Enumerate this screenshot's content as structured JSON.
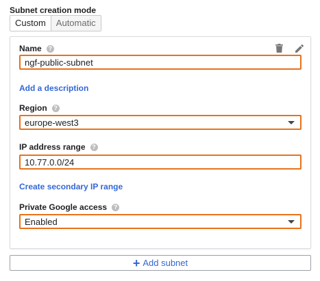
{
  "mode": {
    "label": "Subnet creation mode",
    "options": [
      "Custom",
      "Automatic"
    ],
    "selected": "Custom"
  },
  "card": {
    "name": {
      "label": "Name",
      "value": "ngf-public-subnet",
      "help_icon": "help-icon"
    },
    "add_description": "Add a description",
    "region": {
      "label": "Region",
      "value": "europe-west3",
      "help_icon": "help-icon"
    },
    "ip_range": {
      "label": "IP address range",
      "value": "10.77.0.0/24",
      "help_icon": "help-icon"
    },
    "secondary_range": "Create secondary IP range",
    "private_access": {
      "label": "Private Google access",
      "value": "Enabled",
      "help_icon": "help-icon"
    },
    "icons": {
      "delete": "trash-icon",
      "edit": "pencil-icon"
    }
  },
  "add_subnet": {
    "label": "Add subnet",
    "icon": "plus-icon"
  },
  "colors": {
    "highlight": "#e8711a",
    "link": "#3367d6"
  }
}
